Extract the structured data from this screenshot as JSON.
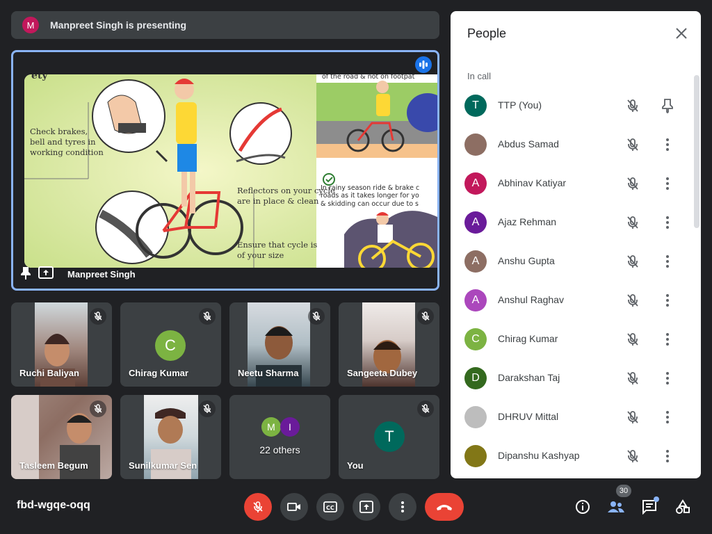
{
  "banner": {
    "avatar_letter": "M",
    "text": "Manpreet Singh is presenting"
  },
  "presentation": {
    "presenter_name": "Manpreet Singh",
    "slide_texts": {
      "corner": "ety",
      "left1": "Check brakes,\nbell and tyres in\nworking condition",
      "middle1": "Reflectors on your cycle\nare in place & clean",
      "middle2": "Ensure that cycle is\nof your size",
      "right_top": "of the road & not on footpat",
      "right_mid": "In rainy season ride & brake c\nroads as it takes longer for yo\n& skidding can occur due to s"
    }
  },
  "tiles": [
    {
      "name": "Ruchi Baliyan",
      "type": "video"
    },
    {
      "name": "Chirag Kumar",
      "type": "avatar",
      "letter": "C",
      "color": "#7cb342"
    },
    {
      "name": "Neetu Sharma",
      "type": "video"
    },
    {
      "name": "Sangeeta Dubey",
      "type": "video"
    },
    {
      "name": "Tasleem Begum",
      "type": "video"
    },
    {
      "name": "Sunilkumar Sen",
      "type": "video"
    },
    {
      "name": "22 others",
      "type": "others",
      "letters": [
        "M",
        "I"
      ]
    },
    {
      "name": "You",
      "type": "avatar",
      "letter": "T",
      "color": "#00695c"
    }
  ],
  "people_panel": {
    "title": "People",
    "section": "In call",
    "participants": [
      {
        "name": "TTP (You)",
        "letter": "T",
        "color": "#00695c",
        "action": "pin-icon"
      },
      {
        "name": "Abdus Samad",
        "letter": "",
        "color": "#8d6e63",
        "action": "more-icon"
      },
      {
        "name": "Abhinav Katiyar",
        "letter": "A",
        "color": "#c2185b",
        "action": "more-icon"
      },
      {
        "name": "Ajaz Rehman",
        "letter": "A",
        "color": "#6a1b9a",
        "action": "more-icon"
      },
      {
        "name": "Anshu Gupta",
        "letter": "A",
        "color": "#8d6e63",
        "action": "more-icon"
      },
      {
        "name": "Anshul Raghav",
        "letter": "A",
        "color": "#ab47bc",
        "action": "more-icon"
      },
      {
        "name": "Chirag Kumar",
        "letter": "C",
        "color": "#7cb342",
        "action": "more-icon"
      },
      {
        "name": "Darakshan Taj",
        "letter": "D",
        "color": "#33691e",
        "action": "more-icon"
      },
      {
        "name": "DHRUV Mittal",
        "letter": "",
        "color": "#bdbdbd",
        "action": "more-icon"
      },
      {
        "name": "Dipanshu Kashyap",
        "letter": "",
        "color": "#827717",
        "action": "more-icon"
      }
    ]
  },
  "toolbar": {
    "meeting_code": "fbd-wgqe-oqq",
    "participant_count": "30"
  },
  "colors": {
    "accent": "#8ab4f8",
    "danger": "#ea4335",
    "surface": "#3c4043",
    "background": "#202124"
  }
}
